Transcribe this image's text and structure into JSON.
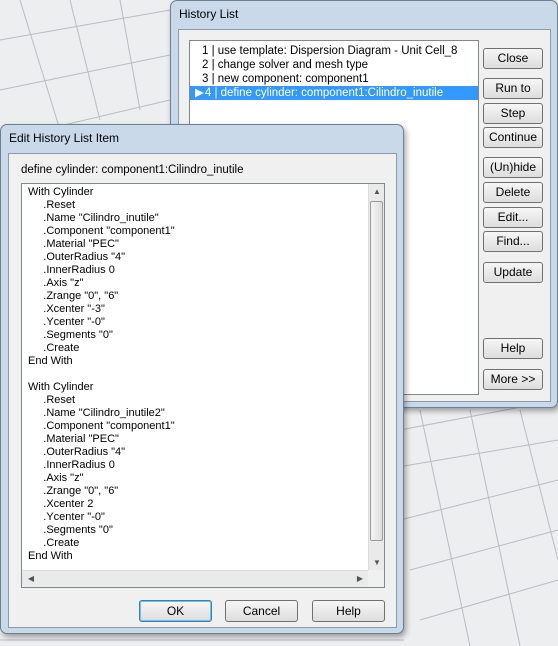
{
  "history_window": {
    "title": "History List",
    "items": [
      {
        "text": "1 | use template: Dispersion Diagram - Unit Cell_8"
      },
      {
        "text": "2 | change solver and mesh type"
      },
      {
        "text": "3 | new component: component1"
      },
      {
        "text": "4 | define cylinder: component1:Cilindro_inutile",
        "marker": "▶",
        "selected": true
      }
    ],
    "buttons": {
      "close": "Close",
      "run_to": "Run to",
      "step": "Step",
      "continue": "Continue",
      "unhide": "(Un)hide",
      "delete": "Delete",
      "edit": "Edit...",
      "find": "Find...",
      "update": "Update",
      "help": "Help",
      "more": "More >>"
    }
  },
  "edit_dialog": {
    "title": "Edit History List Item",
    "label": "define cylinder: component1:Cilindro_inutile",
    "code": "With Cylinder\n     .Reset\n     .Name \"Cilindro_inutile\"\n     .Component \"component1\"\n     .Material \"PEC\"\n     .OuterRadius \"4\"\n     .InnerRadius 0\n     .Axis \"z\"\n     .Zrange \"0\", \"6\"\n     .Xcenter \"-3\"\n     .Ycenter \"-0\"\n     .Segments \"0\"\n     .Create\nEnd With\n\nWith Cylinder\n     .Reset\n     .Name \"Cilindro_inutile2\"\n     .Component \"component1\"\n     .Material \"PEC\"\n     .OuterRadius \"4\"\n     .InnerRadius 0\n     .Axis \"z\"\n     .Zrange \"0\", \"6\"\n     .Xcenter 2\n     .Ycenter \"-0\"\n     .Segments \"0\"\n     .Create\nEnd With",
    "buttons": {
      "ok": "OK",
      "cancel": "Cancel",
      "help": "Help"
    }
  }
}
